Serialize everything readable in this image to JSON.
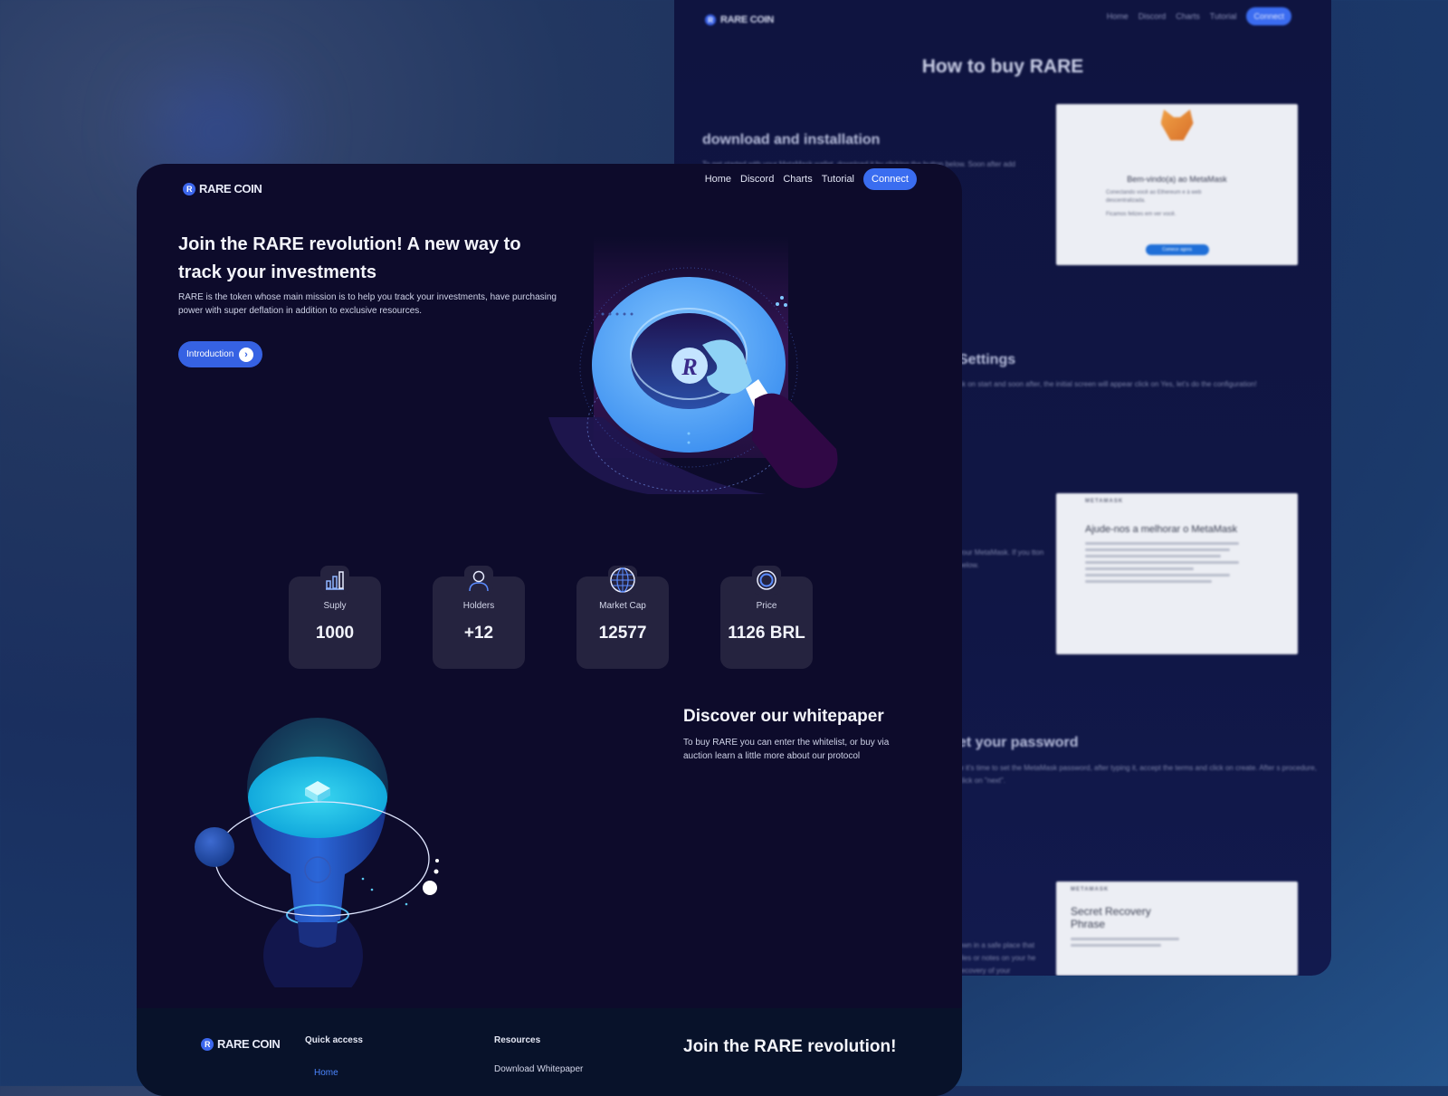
{
  "brand": {
    "logo_letter": "R",
    "name": "RARE COIN"
  },
  "nav": {
    "items": [
      "Home",
      "Discord",
      "Charts",
      "Tutorial"
    ],
    "connect": "Connect"
  },
  "hero": {
    "title": "Join the RARE revolution! A new way to track your investments",
    "description": "RARE is the token whose main mission is to help you track your investments, have purchasing power with super deflation in addition to exclusive resources.",
    "cta": "Introduction",
    "cta_icon": "chevron-right-icon",
    "coin_letter": "R"
  },
  "stats": [
    {
      "icon": "bar-chart-icon",
      "label": "Suply",
      "value": "1000"
    },
    {
      "icon": "user-icon",
      "label": "Holders",
      "value": "+12"
    },
    {
      "icon": "globe-icon",
      "label": "Market Cap",
      "value": "12577"
    },
    {
      "icon": "coin-icon",
      "label": "Price",
      "value": "1126 BRL"
    }
  ],
  "whitepaper": {
    "title": "Discover our whitepaper",
    "description": "To buy RARE you can enter the whitelist, or buy via auction learn a little more about our protocol"
  },
  "footer": {
    "quick_access_title": "Quick access",
    "quick_access_links": [
      "Home"
    ],
    "resources_title": "Resources",
    "resources_links": [
      "Download Whitepaper"
    ],
    "cta_title": "Join the RARE revolution!"
  },
  "tutorial_page": {
    "title": "How to buy RARE",
    "sections": [
      {
        "heading": "download and installation",
        "text": "To get started with your MetaMask wallet, download it by clicking the button below. Soon after add"
      },
      {
        "heading": "Settings",
        "text": "ck on start and soon after, the initial screen will appear click on Yes, let's do the configuration!"
      },
      {
        "heading": "",
        "text": "your MetaMask. If you tton below."
      },
      {
        "heading": "et your password",
        "text": "w it's time to set the MetaMask password, after typing it, accept the terms and click on create. After s procedure, click on \"next\"."
      },
      {
        "heading": "",
        "text": "own in a safe place that files or notes on your he recovery of your"
      }
    ],
    "screenshots": [
      {
        "title": "Bem-vindo(a) ao MetaMask",
        "text": "Conectando você ao Ethereum e à web descentralizada.",
        "text2": "Ficamos felizes em ver você.",
        "button": "Comece agora"
      },
      {
        "brand": "METAMASK",
        "title": "Ajude-nos a melhorar o MetaMask"
      },
      {
        "brand": "METAMASK",
        "title": "Secret Recovery Phrase"
      }
    ]
  },
  "colors": {
    "accent": "#3a6df0",
    "background": "#0d0b2b",
    "card": "#25233f"
  }
}
